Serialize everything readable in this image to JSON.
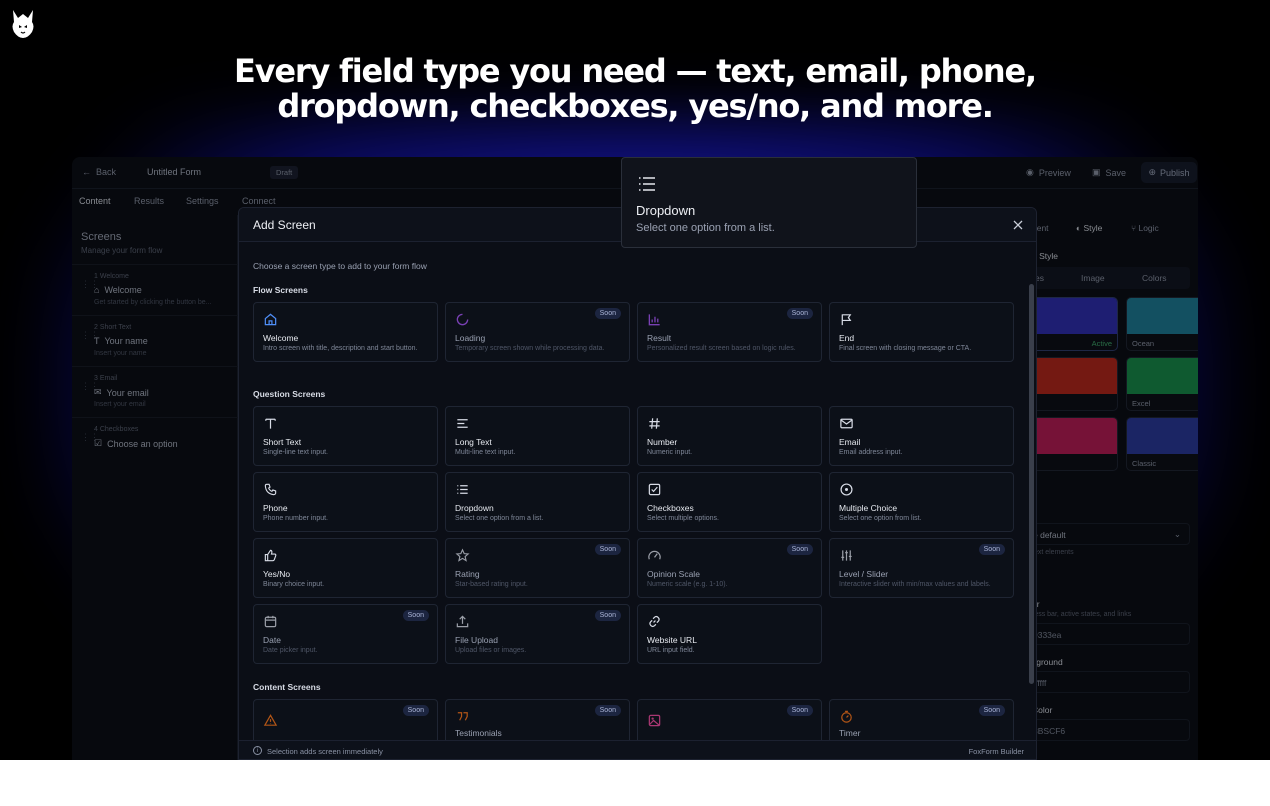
{
  "headline": {
    "line1": "Every field type you need — text, email, phone,",
    "line2": "dropdown, checkboxes, yes/no, and more."
  },
  "colors": {
    "accent": "#3b82f6",
    "background": "#000000",
    "panel": "#0b0e16",
    "soon_badge": "#1c2540"
  },
  "topbar": {
    "back": "Back",
    "form_title": "Untitled Form",
    "status": "Draft",
    "preview": "Preview",
    "save": "Save",
    "publish": "Publish"
  },
  "nav_tabs": [
    "Content",
    "Results",
    "Settings",
    "Connect"
  ],
  "screens_panel": {
    "title": "Screens",
    "subtitle": "Manage your form flow",
    "items": [
      {
        "number": "1  Welcome",
        "title": "Welcome",
        "desc": "Get started by clicking the button be...",
        "icon": "home-icon"
      },
      {
        "number": "2  Short Text",
        "title": "Your name",
        "desc": "Insert your name",
        "icon": "text-icon"
      },
      {
        "number": "3  Email",
        "title": "Your email",
        "desc": "Insert your email",
        "icon": "mail-icon"
      },
      {
        "number": "4  Checkboxes",
        "title": "Choose an option",
        "desc": "",
        "icon": "checkbox-icon"
      }
    ]
  },
  "right_panel": {
    "tab_partial": "nent",
    "tab_style": "Style",
    "tab_logic": "Logic",
    "section_partial": "d Style",
    "subtab_partial": "es",
    "subtab_image": "Image",
    "subtab_colors": "Colors",
    "themes": [
      {
        "label": "Active",
        "color": "#2f2fb0"
      },
      {
        "label": "Ocean",
        "color": "#1e7b95"
      },
      {
        "label": "",
        "color": "#b3271d"
      },
      {
        "label": "Excel",
        "color": "#178a4a"
      },
      {
        "label": "",
        "color": "#b51d55"
      },
      {
        "label": "Classic",
        "color": "#2a3a9a"
      }
    ],
    "font_partial": "y",
    "font_value_partial": "e default",
    "font_desc_partial": "text elements",
    "color_label_partial": "or",
    "color_desc_partial": "ress bar, active states, and links",
    "color_value_partial": "9333ea",
    "bg_label_partial": "kground",
    "bg_value_partial": "ffffff",
    "text_label_partial": "Color",
    "text_value_partial": "8BSCF6"
  },
  "modal": {
    "title": "Add Screen",
    "intro": "Choose a screen type to add to your form flow",
    "soon_label": "Soon",
    "sections": [
      {
        "title": "Flow Screens",
        "cards": [
          {
            "title": "Welcome",
            "desc": "Intro screen with title, description and start button.",
            "icon": "home-icon",
            "soon": false
          },
          {
            "title": "Loading",
            "desc": "Temporary screen shown while processing data.",
            "icon": "loader-icon",
            "soon": true
          },
          {
            "title": "Result",
            "desc": "Personalized result screen based on logic rules.",
            "icon": "bar-chart-icon",
            "soon": true
          },
          {
            "title": "End",
            "desc": "Final screen with closing message or CTA.",
            "icon": "flag-icon",
            "soon": false
          }
        ]
      },
      {
        "title": "Question Screens",
        "cards": [
          {
            "title": "Short Text",
            "desc": "Single-line text input.",
            "icon": "text-icon",
            "soon": false
          },
          {
            "title": "Long Text",
            "desc": "Multi-line text input.",
            "icon": "align-left-icon",
            "soon": false
          },
          {
            "title": "Number",
            "desc": "Numeric input.",
            "icon": "hash-icon",
            "soon": false
          },
          {
            "title": "Email",
            "desc": "Email address input.",
            "icon": "mail-icon",
            "soon": false
          },
          {
            "title": "Phone",
            "desc": "Phone number input.",
            "icon": "phone-icon",
            "soon": false
          },
          {
            "title": "Dropdown",
            "desc": "Select one option from a list.",
            "icon": "list-icon",
            "soon": false
          },
          {
            "title": "Checkboxes",
            "desc": "Select multiple options.",
            "icon": "checkbox-icon",
            "soon": false
          },
          {
            "title": "Multiple Choice",
            "desc": "Select one option from list.",
            "icon": "radio-icon",
            "soon": false
          },
          {
            "title": "Yes/No",
            "desc": "Binary choice input.",
            "icon": "thumbs-up-icon",
            "soon": false
          },
          {
            "title": "Rating",
            "desc": "Star-based rating input.",
            "icon": "star-icon",
            "soon": true
          },
          {
            "title": "Opinion Scale",
            "desc": "Numeric scale (e.g. 1-10).",
            "icon": "gauge-icon",
            "soon": true
          },
          {
            "title": "Level / Slider",
            "desc": "Interactive slider with min/max values and labels.",
            "icon": "sliders-icon",
            "soon": true
          },
          {
            "title": "Date",
            "desc": "Date picker input.",
            "icon": "calendar-icon",
            "soon": true
          },
          {
            "title": "File Upload",
            "desc": "Upload files or images.",
            "icon": "upload-icon",
            "soon": true
          },
          {
            "title": "Website URL",
            "desc": "URL input field.",
            "icon": "link-icon",
            "soon": false
          }
        ]
      },
      {
        "title": "Content Screens",
        "cards": [
          {
            "title": "",
            "desc": "",
            "icon": "alert-triangle-icon",
            "soon": true
          },
          {
            "title": "Testimonials",
            "desc": "",
            "icon": "quote-icon",
            "soon": true
          },
          {
            "title": "",
            "desc": "",
            "icon": "image-icon",
            "soon": true
          },
          {
            "title": "Timer",
            "desc": "",
            "icon": "timer-icon",
            "soon": true
          }
        ]
      }
    ],
    "footer_note": "Selection adds screen immediately",
    "footer_brand": "FoxForm Builder"
  },
  "tooltip": {
    "title": "Dropdown",
    "desc": "Select one option from a list."
  }
}
